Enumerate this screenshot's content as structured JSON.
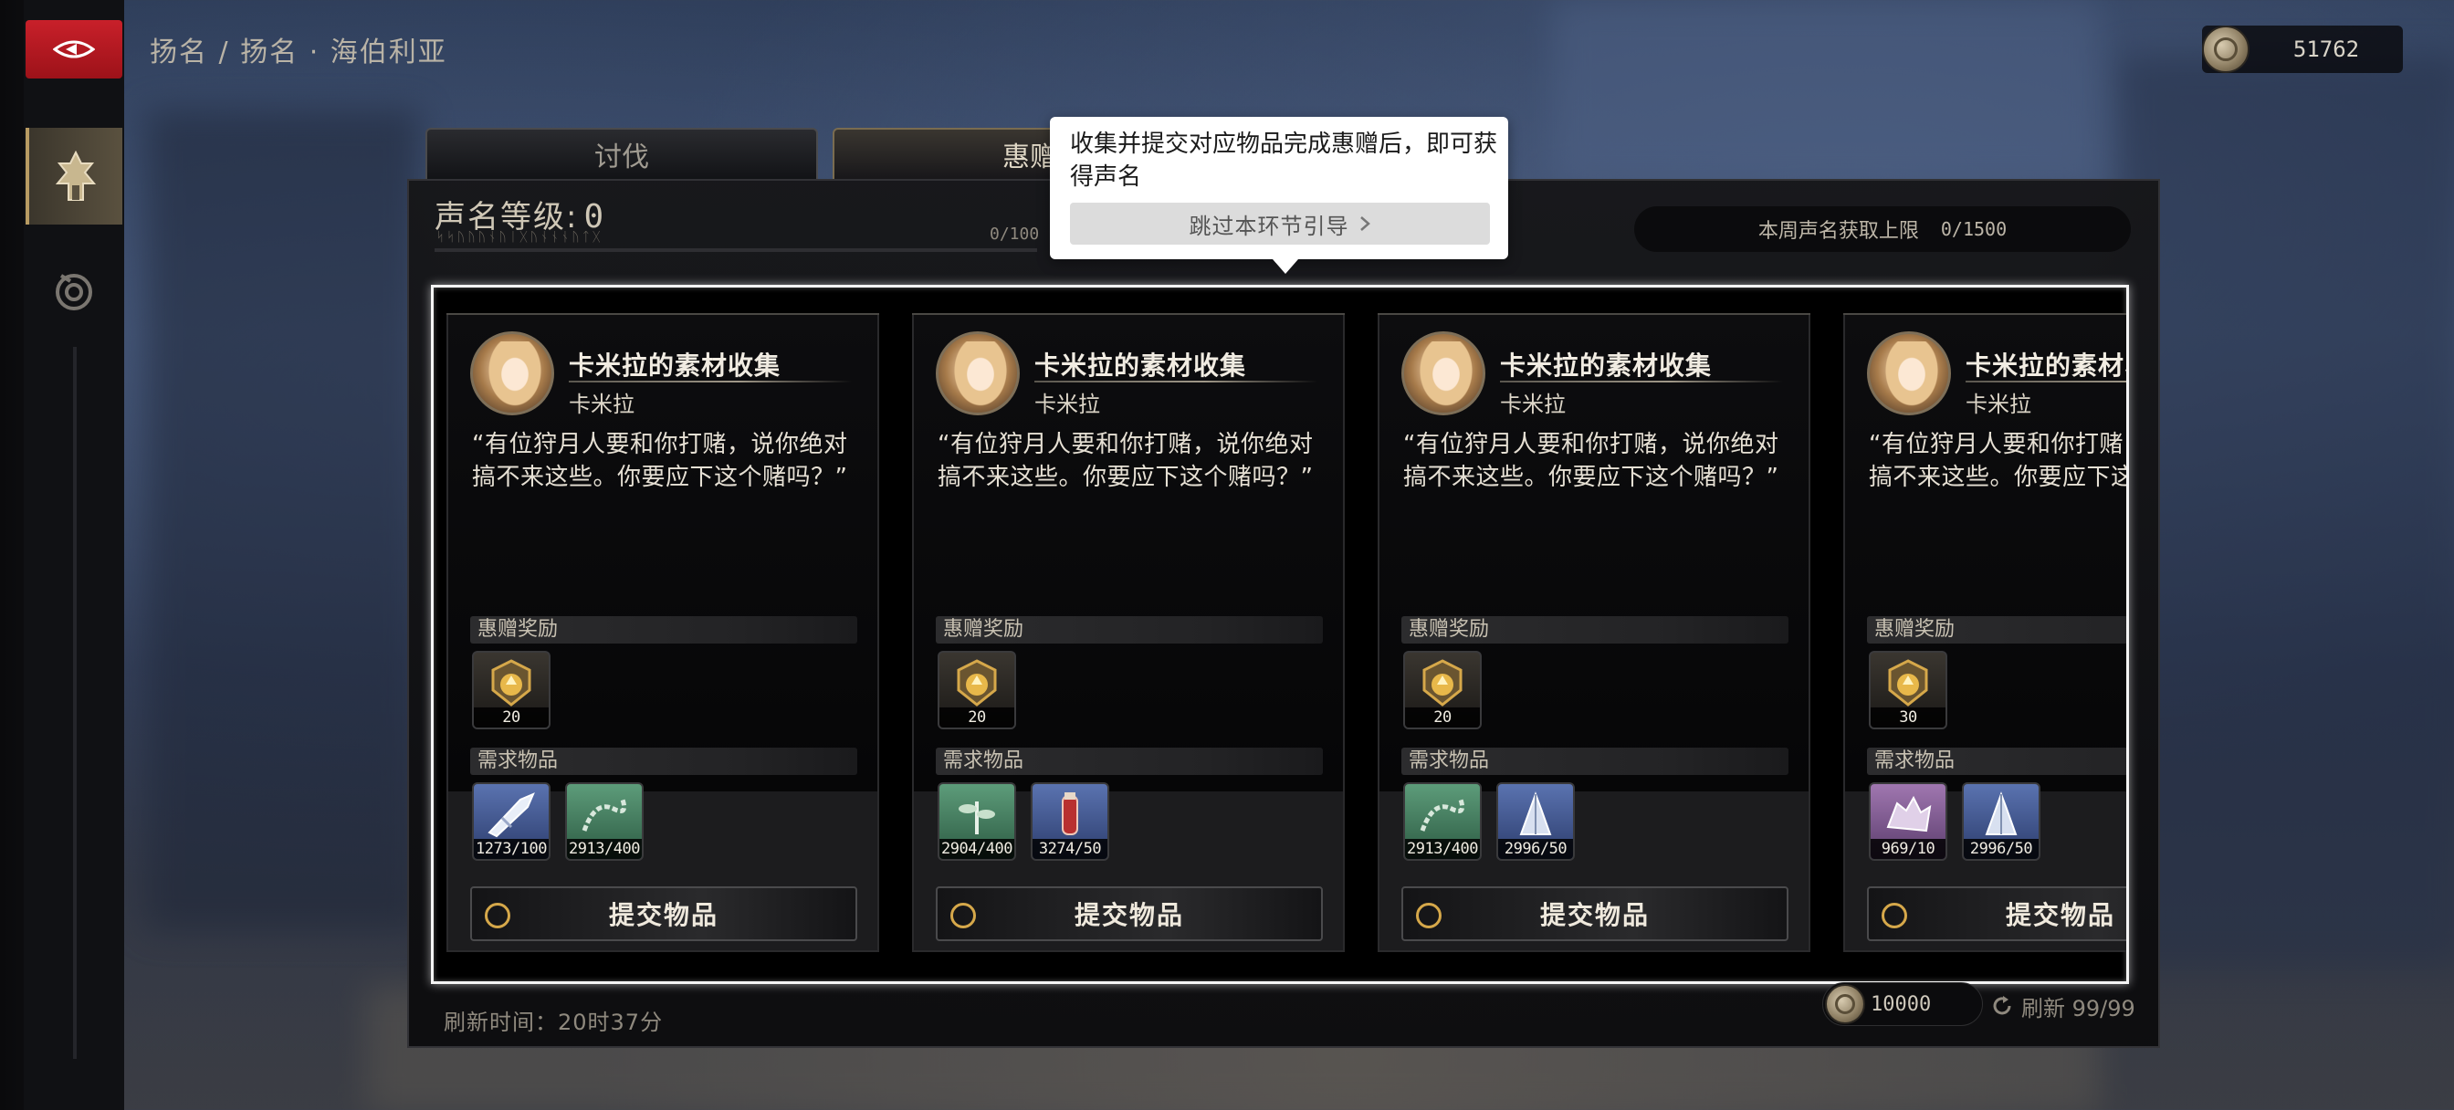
{
  "breadcrumb": "扬名 / 扬名 · 海伯利亚",
  "currency": {
    "amount": "51762",
    "icon": "coin-icon"
  },
  "tabs": [
    {
      "label": "讨伐"
    },
    {
      "label": "惠赠"
    }
  ],
  "reputation": {
    "label": "声名等级:",
    "level": "0",
    "progress": "0/100",
    "progress_fraction": 0.0,
    "runes": "ᛋᛋᚢᚢᚢᚾᚢᛁᚷᚢᚾᚾᚾᚢᛏᚷ"
  },
  "weekly": {
    "label": "本周声名获取上限",
    "value": "0/1500"
  },
  "tooltip": {
    "text": "收集并提交对应物品完成惠赠后，即可获得声名",
    "skip_label": "跳过本环节引导",
    "skip_icon": "chevron-right-icon"
  },
  "sections": {
    "reward": "惠赠奖励",
    "required": "需求物品"
  },
  "cards": [
    {
      "title": "卡米拉的素材收集",
      "npc": "卡米拉",
      "quote": "“有位狩月人要和你打赌，说你绝对搞不来这些。你要应下这个赌吗？”",
      "reward": {
        "count": "20",
        "icon": "reputation-emblem-icon"
      },
      "items": [
        {
          "count": "1273/100",
          "icon": "silver-blade-icon",
          "rarity": "blue"
        },
        {
          "count": "2913/400",
          "icon": "chain-whip-icon",
          "rarity": "green"
        }
      ],
      "submit": "提交物品"
    },
    {
      "title": "卡米拉的素材收集",
      "npc": "卡米拉",
      "quote": "“有位狩月人要和你打赌，说你绝对搞不来这些。你要应下这个赌吗？”",
      "reward": {
        "count": "20",
        "icon": "reputation-emblem-icon"
      },
      "items": [
        {
          "count": "2904/400",
          "icon": "herb-icon",
          "rarity": "green"
        },
        {
          "count": "3274/50",
          "icon": "red-vial-icon",
          "rarity": "blue"
        }
      ],
      "submit": "提交物品"
    },
    {
      "title": "卡米拉的素材收集",
      "npc": "卡米拉",
      "quote": "“有位狩月人要和你打赌，说你绝对搞不来这些。你要应下这个赌吗？”",
      "reward": {
        "count": "20",
        "icon": "reputation-emblem-icon"
      },
      "items": [
        {
          "count": "2913/400",
          "icon": "chain-whip-icon",
          "rarity": "green"
        },
        {
          "count": "2996/50",
          "icon": "spike-shard-icon",
          "rarity": "blue"
        }
      ],
      "submit": "提交物品"
    },
    {
      "title": "卡米拉的素材收集",
      "npc": "卡米拉",
      "quote": "“有位狩月人要和你打赌，说你绝对搞不来这些。你要应下这个赌吗？”",
      "reward": {
        "count": "30",
        "icon": "reputation-emblem-icon"
      },
      "items": [
        {
          "count": "969/10",
          "icon": "crystal-beast-icon",
          "rarity": "purple"
        },
        {
          "count": "2996/50",
          "icon": "spike-shard-icon",
          "rarity": "blue"
        }
      ],
      "submit": "提交物品"
    }
  ],
  "footer": {
    "refresh_label": "刷新时间：",
    "refresh_time": "20时37分",
    "cost": "10000",
    "refresh_count": "刷新 99/99"
  },
  "colors": {
    "accent_gold": "#d6a84a",
    "back_red": "#c8202a",
    "highlight": "#f4f4f4"
  }
}
